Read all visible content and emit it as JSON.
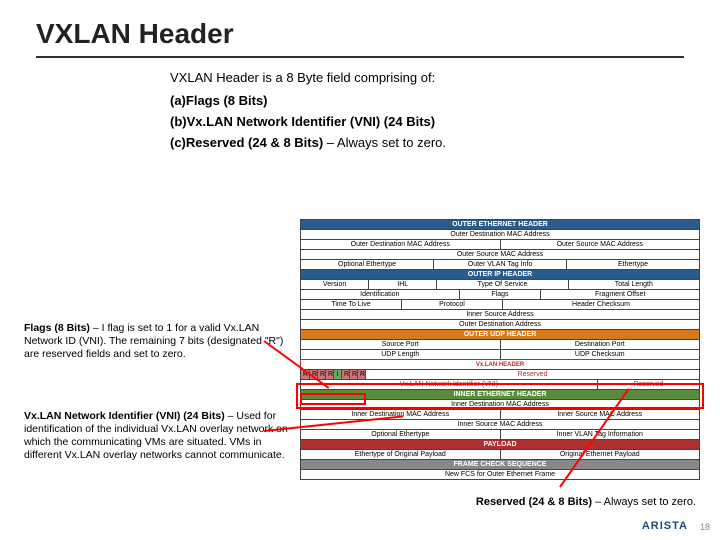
{
  "title": "VXLAN Header",
  "intro": "VXLAN Header is a  8 Byte field comprising of:",
  "bullets": {
    "a": {
      "tag": "(a)",
      "text": "Flags (8 Bits)"
    },
    "b": {
      "tag": "(b)",
      "text": "Vx.LAN Network Identifier (VNI) (24 Bits)"
    },
    "c": {
      "tag": "(c)",
      "text": "Reserved (24 & 8 Bits)",
      "suffix": " – Always set to zero."
    }
  },
  "notes": {
    "flags": {
      "bold": "Flags (8 Bits)",
      "rest": " – I flag is set to 1 for a valid Vx.LAN Network ID (VNI). The remaining 7 bits (designated \"R\") are reserved fields and set to zero."
    },
    "vni": {
      "bold": "Vx.LAN Network Identifier (VNI) (24 Bits)",
      "rest": " – Used for identification of the individual Vx.LAN overlay network on which the communicating VMs are situated. VMs in different Vx.LAN overlay networks cannot communicate."
    },
    "reserved": {
      "bold": "Reserved (24 & 8 Bits)",
      "rest": " – Always set to zero."
    }
  },
  "diagram": {
    "outer_eth": "OUTER ETHERNET HEADER",
    "outer_eth_rows": {
      "r1": {
        "a": "Outer Destination MAC Address"
      },
      "r2": {
        "a": "Outer Destination MAC Address",
        "b": "Outer Source MAC Address"
      },
      "r3": {
        "a": "Outer Source MAC Address"
      },
      "r4": {
        "a": "Optional Ethertype",
        "b": "Outer VLAN Tag Info",
        "c": "Ethertype"
      }
    },
    "outer_ip": "OUTER IP HEADER",
    "outer_ip_rows": {
      "r1": {
        "a": "Version",
        "b": "IHL",
        "c": "Type Of Service",
        "d": "Total Length"
      },
      "r2": {
        "a": "Identification",
        "b": "Flags",
        "c": "Fragment Offset"
      },
      "r3": {
        "a": "Time To Live",
        "b": "Protocol",
        "c": "Header Checksum"
      },
      "r4": {
        "a": "Inner Source Address"
      },
      "r5": {
        "a": "Outer Destination Address"
      }
    },
    "outer_udp": "OUTER UDP HEADER",
    "outer_udp_rows": {
      "r1": {
        "a": "Source Port",
        "b": "Destination Port"
      },
      "r2": {
        "a": "UDP Length",
        "b": "UDP Checksum"
      }
    },
    "vxlan": "Vx.LAN  HEADER",
    "vxlan_rows": {
      "flags": {
        "r1": "R",
        "r2": "R",
        "r3": "R",
        "r4": "R",
        "i": "I",
        "r5": "R",
        "r6": "R",
        "r7": "R"
      },
      "r1": {
        "a": "Reserved"
      },
      "r2": {
        "a": "Vx.LAN  Network Identifier (VNI)",
        "b": "Reserved"
      }
    },
    "inner_eth": "INNER ETHERNET HEADER",
    "inner_eth_rows": {
      "r1": {
        "a": "Inner Destination MAC Address"
      },
      "r2": {
        "a": "Inner Destination MAC Address",
        "b": "Inner Source MAC Address"
      },
      "r3": {
        "a": "Inner Source MAC Address"
      },
      "r4": {
        "a": "Optional Ethertype",
        "b": "Inner VLAN Tag Information"
      }
    },
    "payload": "PAYLOAD",
    "payload_rows": {
      "r1": {
        "a": "Ethertype of Original Payload",
        "b": "Original Ethernet Payload"
      }
    },
    "fcs": "FRAME CHECK SEQUENCE",
    "fcs_rows": {
      "r1": {
        "a": "New FCS for Outer Ethernet Frame"
      }
    }
  },
  "brand": "ARISTA",
  "pagenum": "18"
}
